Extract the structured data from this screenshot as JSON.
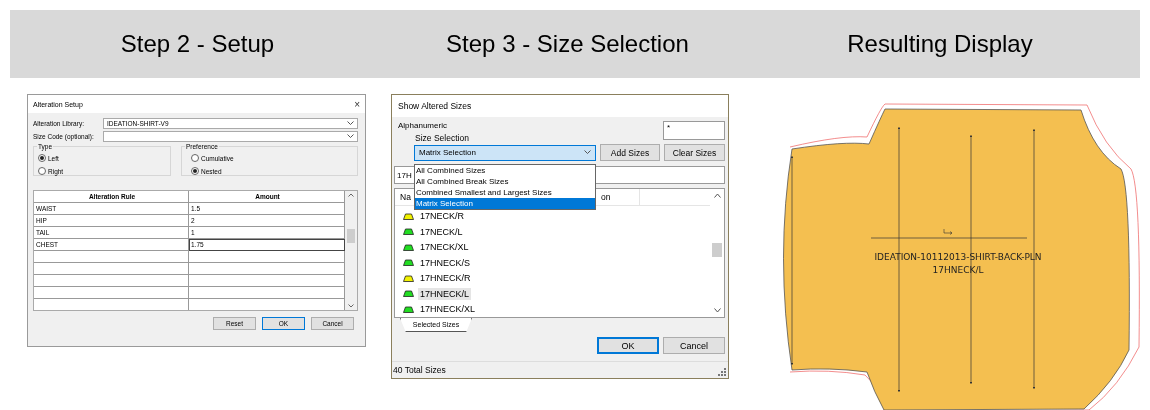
{
  "header": {
    "titles": [
      "Step 2 - Setup",
      "Step 3 - Size Selection",
      "Resulting Display"
    ]
  },
  "setup_dialog": {
    "title": "Alteration Setup",
    "close_icon": "×",
    "fields": [
      {
        "label": "Alteration Library:",
        "value": "IDEATION-SHIRT-V9"
      },
      {
        "label": "Size Code (optional):"
      }
    ],
    "groups": [
      {
        "title": "Type",
        "options": [
          {
            "label": "Left",
            "selected": true
          },
          {
            "label": "Right",
            "selected": false
          }
        ]
      },
      {
        "title": "Preference",
        "options": [
          {
            "label": "Cumulative",
            "selected": false
          },
          {
            "label": "Nested",
            "selected": true
          }
        ]
      }
    ],
    "table": {
      "columns": [
        "Alteration Rule",
        "Amount"
      ],
      "rows": [
        {
          "rule": "WAIST",
          "amount": "1.5",
          "focused": false
        },
        {
          "rule": "HIP",
          "amount": "2",
          "focused": false
        },
        {
          "rule": "TAIL",
          "amount": "1",
          "focused": false
        },
        {
          "rule": "CHEST",
          "amount": "1.75",
          "focused": true
        }
      ]
    },
    "buttons": [
      {
        "label": "Reset",
        "default": false
      },
      {
        "label": "OK",
        "default": true
      },
      {
        "label": "Cancel",
        "default": false
      }
    ]
  },
  "sizes_dialog": {
    "title": "Show Altered Sizes",
    "mode_label": "Alphanumeric",
    "filter_value": "*",
    "selection_label": "Size Selection",
    "combo_value": "Matrix Selection",
    "top_buttons": [
      "Add Sizes",
      "Clear Sizes"
    ],
    "dropdown": [
      {
        "label": "All Combined Sizes",
        "selected": false
      },
      {
        "label": "All Combined Break Sizes",
        "selected": false
      },
      {
        "label": "Combined Smallest and Largest Sizes",
        "selected": false
      },
      {
        "label": "Matrix Selection",
        "selected": true
      }
    ],
    "search_value": "17H",
    "columns": [
      "Na",
      "on"
    ],
    "sizes": [
      {
        "name": "17NECK/R",
        "color": "#f2f200",
        "hovered": false
      },
      {
        "name": "17NECK/L",
        "color": "#22dd22",
        "hovered": false
      },
      {
        "name": "17NECK/XL",
        "color": "#22dd22",
        "hovered": false
      },
      {
        "name": "17HNECK/S",
        "color": "#22dd22",
        "hovered": false
      },
      {
        "name": "17HNECK/R",
        "color": "#f2f200",
        "hovered": false
      },
      {
        "name": "17HNECK/L",
        "color": "#22dd22",
        "hovered": true
      },
      {
        "name": "17HNECK/XL",
        "color": "#22dd22",
        "hovered": false
      }
    ],
    "tab": "Selected Sizes",
    "buttons": [
      {
        "label": "OK",
        "default": true
      },
      {
        "label": "Cancel",
        "default": false
      }
    ],
    "status": "40 Total Sizes"
  },
  "pattern": {
    "piece_name": "IDEATION-10112013-SHIRT-BACK-PLN",
    "size": "17HNECK/L"
  }
}
